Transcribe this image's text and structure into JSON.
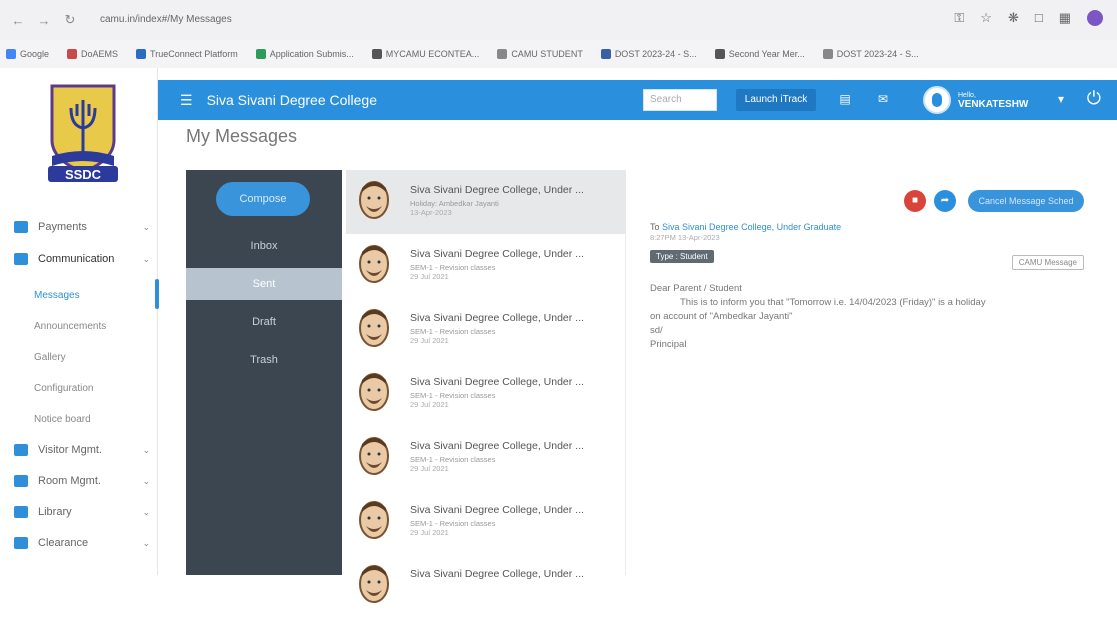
{
  "browser": {
    "url": "camu.in/index#/My Messages",
    "bookmarks": [
      {
        "label": "Google",
        "color": "#4285f4"
      },
      {
        "label": "DoAEMS",
        "color": "#c94a4a"
      },
      {
        "label": "TrueConnect Platform",
        "color": "#2a6cbf"
      },
      {
        "label": "Application Submis...",
        "color": "#2c9c5a"
      },
      {
        "label": "MYCAMU ECONTEA...",
        "color": "#555555"
      },
      {
        "label": "CAMU STUDENT",
        "color": "#888888"
      },
      {
        "label": "DOST 2023-24 - S...",
        "color": "#3a5ea8"
      },
      {
        "label": "Second Year Mer...",
        "color": "#555555"
      },
      {
        "label": "DOST 2023-24 - S...",
        "color": "#888888"
      }
    ]
  },
  "sidebar": {
    "logo_text": "SSDC",
    "items": [
      {
        "label": "Payments",
        "color": "#2f8fd8"
      },
      {
        "label": "Communication",
        "color": "#2f8fd8"
      }
    ],
    "sub_items": [
      {
        "label": "Messages"
      },
      {
        "label": "Announcements"
      },
      {
        "label": "Gallery"
      },
      {
        "label": "Configuration"
      },
      {
        "label": "Notice board"
      }
    ],
    "bottom_items": [
      {
        "label": "Visitor Mgmt.",
        "color": "#2f8fd8"
      },
      {
        "label": "Room Mgmt.",
        "color": "#2f8fd8"
      },
      {
        "label": "Library",
        "color": "#2f8fd8"
      },
      {
        "label": "Clearance",
        "color": "#2f8fd8"
      }
    ]
  },
  "topnav": {
    "college_name": "Siva Sivani Degree College",
    "search_placeholder": "Search",
    "launch_label": "Launch iTrack",
    "user_greeting": "Hello,",
    "user_name": "VENKATESHW",
    "accent": "#2a8fdc"
  },
  "page": {
    "title": "My Messages"
  },
  "folders": {
    "compose_label": "Compose",
    "items": [
      {
        "label": "Inbox"
      },
      {
        "label": "Sent"
      },
      {
        "label": "Draft"
      },
      {
        "label": "Trash"
      }
    ],
    "active_index": 1
  },
  "messages": [
    {
      "sender": "Siva Sivani Degree College, Under ...",
      "subject": "Holiday: Ambedkar Jayanti",
      "date": "13-Apr-2023"
    },
    {
      "sender": "Siva Sivani Degree College, Under ...",
      "subject": "SEM-1 - Revision classes",
      "date": "29 Jul 2021"
    },
    {
      "sender": "Siva Sivani Degree College, Under ...",
      "subject": "SEM-1 - Revision classes",
      "date": "29 Jul 2021"
    },
    {
      "sender": "Siva Sivani Degree College, Under ...",
      "subject": "SEM-1 - Revision classes",
      "date": "29 Jul 2021"
    },
    {
      "sender": "Siva Sivani Degree College, Under ...",
      "subject": "SEM-1 - Revision classes",
      "date": "29 Jul 2021"
    },
    {
      "sender": "Siva Sivani Degree College, Under ...",
      "subject": "SEM-1 - Revision classes",
      "date": "29 Jul 2021"
    },
    {
      "sender": "Siva Sivani Degree College, Under ...",
      "subject": "",
      "date": ""
    }
  ],
  "detail": {
    "cancel_label": "Cancel Message Sched",
    "to_prefix": "To",
    "to_name": "Siva Sivani Degree College, Under Graduate",
    "time": "8:27PM 13-Apr-2023",
    "type_badge": "Type : Student",
    "camu_badge": "CAMU Message",
    "greeting": "Dear Parent / Student",
    "body": "This is to inform you that \"Tomorrow i.e. 14/04/2023 (Friday)\" is a holiday",
    "body2": "on account of \"Ambedkar Jayanti\"",
    "sign1": "sd/",
    "sign2": "Principal",
    "delete_color": "#d9443a",
    "forward_color": "#2a8fdc"
  }
}
